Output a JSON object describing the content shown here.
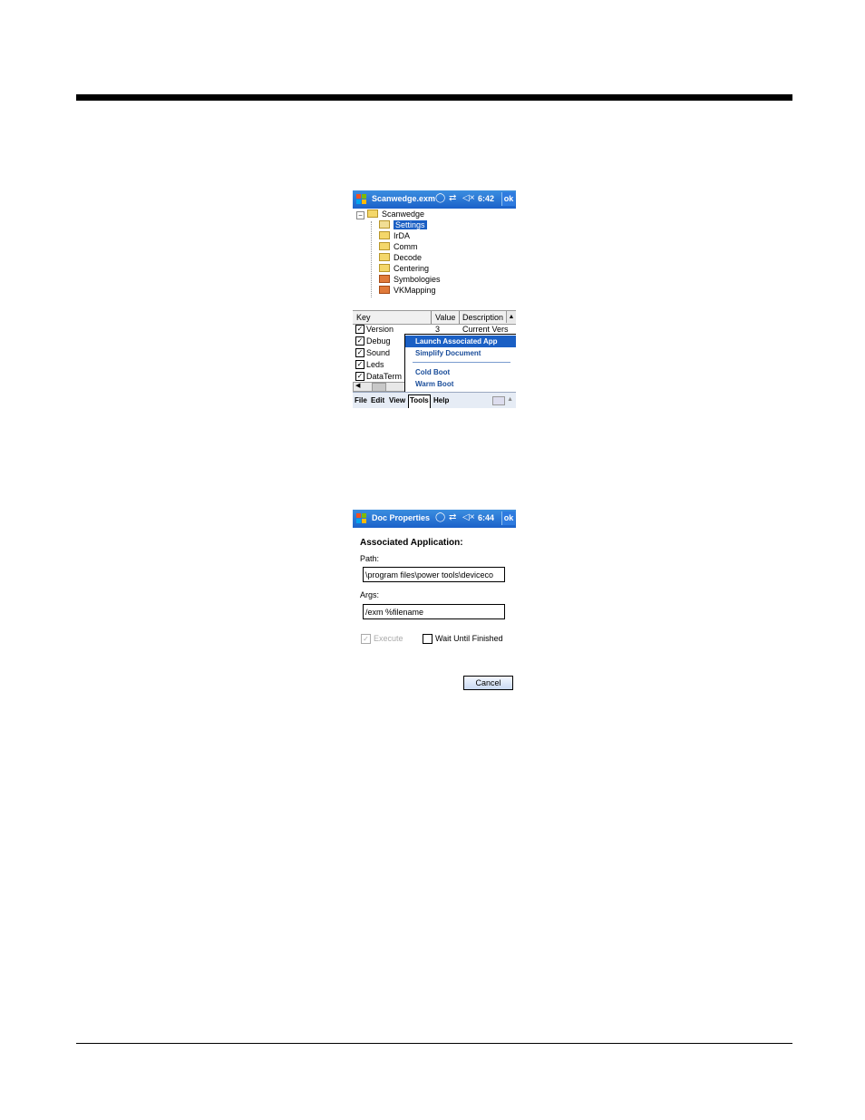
{
  "screen1": {
    "title_bar": {
      "app_title": "Scanwedge.exm",
      "time": "6:42",
      "ok_label": "ok"
    },
    "tree": {
      "root": "Scanwedge",
      "children": [
        "Settings",
        "IrDA",
        "Comm",
        "Decode",
        "Centering",
        "Symbologies",
        "VKMapping"
      ]
    },
    "list": {
      "headers": {
        "key": "Key",
        "value": "Value",
        "description": "Description"
      },
      "rows": [
        {
          "key": "Version",
          "value": "3",
          "description": "Current Vers"
        },
        {
          "key": "Debug"
        },
        {
          "key": "Sound"
        },
        {
          "key": "Leds"
        },
        {
          "key": "DataTerm"
        }
      ]
    },
    "tools_menu": {
      "items": [
        "Launch Associated App",
        "Simplify Document",
        "Cold Boot",
        "Warm Boot"
      ]
    },
    "menubar": {
      "file": "File",
      "edit": "Edit",
      "view": "View",
      "tools": "Tools",
      "help": "Help"
    }
  },
  "screen2": {
    "title_bar": {
      "app_title": "Doc Properties",
      "time": "6:44",
      "ok_label": "ok"
    },
    "heading": "Associated Application:",
    "path_label": "Path:",
    "path_value": "\\program files\\power tools\\deviceco",
    "args_label": "Args:",
    "args_value": "/exm %filename",
    "execute_label": "Execute",
    "wait_label": "Wait Until Finished",
    "cancel_label": "Cancel"
  }
}
